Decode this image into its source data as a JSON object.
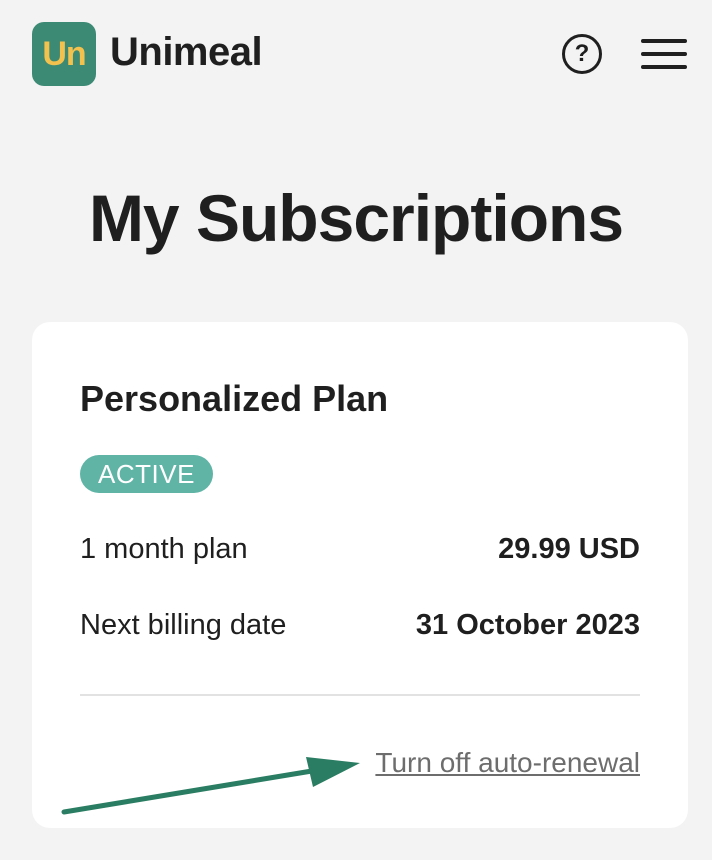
{
  "header": {
    "logo_mark": "Un",
    "logo_text": "Unimeal",
    "help_label": "?"
  },
  "page": {
    "title": "My Subscriptions"
  },
  "subscription": {
    "plan_name": "Personalized Plan",
    "status": "ACTIVE",
    "plan_label": "1 month plan",
    "price": "29.99 USD",
    "billing_label": "Next billing date",
    "billing_date": "31 October 2023",
    "renewal_link": "Turn off auto-renewal"
  },
  "colors": {
    "brand": "#3d8a74",
    "brand_text": "#f2c14e",
    "badge": "#5fb4a6",
    "annotation_arrow": "#2a7d62"
  }
}
